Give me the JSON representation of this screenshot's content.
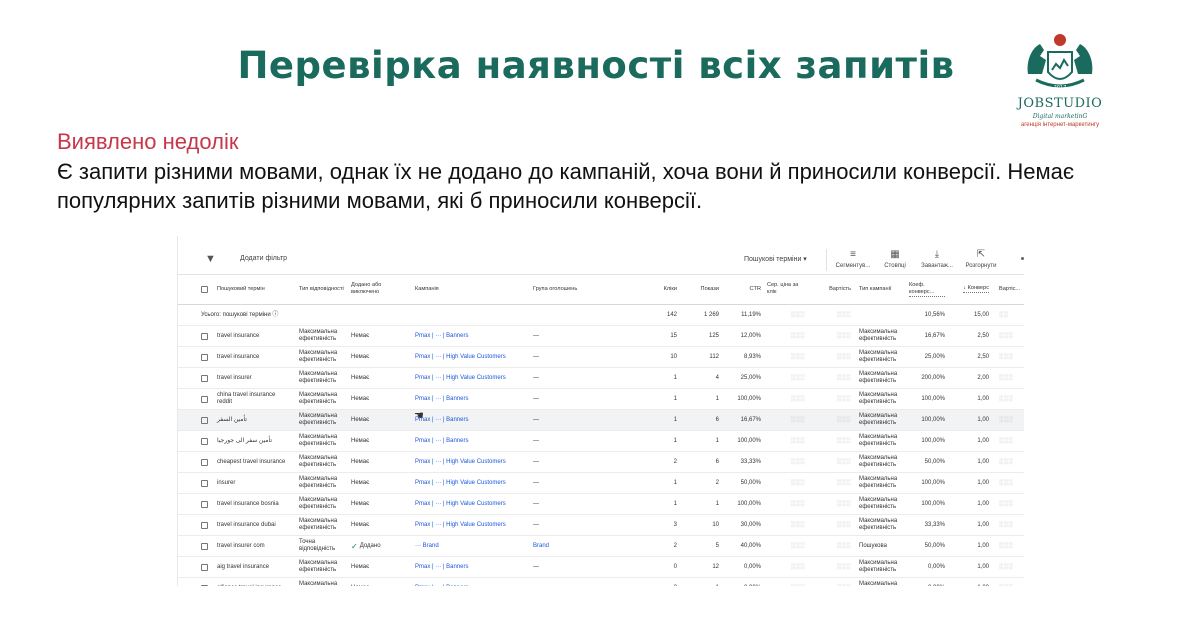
{
  "slide": {
    "title": "Перевірка наявності всіх запитів",
    "issue_label": "Виявлено недолік",
    "issue_text": "Є запити різними мовами, однак їх не додано до кампаній, хоча вони й приносили конверсії. Немає популярних запитів різними мовами, які б приносили конверсії.",
    "logo": {
      "brand": "JOBSTUDIO",
      "tagline": "Digital marketinG",
      "caption": "агенція інтернет-маркетингу",
      "colors": {
        "primary": "#1a6b5e",
        "accent": "#c0392b"
      }
    }
  },
  "toolbar": {
    "add_filter": "Додати фільтр",
    "view_select": "Пошукові терміни",
    "buttons": [
      {
        "label": "Сегментув...",
        "icon": "segment-icon"
      },
      {
        "label": "Стовпці",
        "icon": "columns-icon"
      },
      {
        "label": "Завантаж...",
        "icon": "download-icon"
      },
      {
        "label": "Розгорнути",
        "icon": "expand-icon"
      }
    ]
  },
  "table": {
    "headers": {
      "term": "Пошуковий термін",
      "match": "Тип відповідності",
      "added": "Додано або виключено",
      "campaign": "Кампанія",
      "adgroup": "Група оголошень",
      "clicks": "Кліки",
      "impr": "Покази",
      "ctr": "CTR",
      "cpc": "Сер. ціна за клік",
      "cost": "Вартість",
      "ctype": "Тип кампанії",
      "convrate": "Коеф. конверс...",
      "conv": "↓ Конверс",
      "convval": "Вартіс..."
    },
    "total": {
      "label": "Усього: пошукові терміни",
      "clicks": "142",
      "impr": "1 269",
      "ctr": "11,19%",
      "convrate": "10,56%",
      "conv": "15,00"
    },
    "rows": [
      {
        "term": "travel insurance",
        "match": "Максимальна ефективність",
        "added": "Немає",
        "campaign": "Pmax | ··· | Banners",
        "adgroup": "—",
        "clicks": "15",
        "impr": "125",
        "ctr": "12,00%",
        "ctype": "Максимальна ефективність",
        "convrate": "16,67%",
        "conv": "2,50"
      },
      {
        "term": "travel insurance",
        "match": "Максимальна ефективність",
        "added": "Немає",
        "campaign": "Pmax | ··· | High Value Customers",
        "adgroup": "—",
        "clicks": "10",
        "impr": "112",
        "ctr": "8,93%",
        "ctype": "Максимальна ефективність",
        "convrate": "25,00%",
        "conv": "2,50"
      },
      {
        "term": "travel insurer",
        "match": "Максимальна ефективність",
        "added": "Немає",
        "campaign": "Pmax | ··· | High Value Customers",
        "adgroup": "—",
        "clicks": "1",
        "impr": "4",
        "ctr": "25,00%",
        "ctype": "Максимальна ефективність",
        "convrate": "200,00%",
        "conv": "2,00"
      },
      {
        "term": "china travel insurance reddit",
        "match": "Максимальна ефективність",
        "added": "Немає",
        "campaign": "Pmax | ··· | Banners",
        "adgroup": "—",
        "clicks": "1",
        "impr": "1",
        "ctr": "100,00%",
        "ctype": "Максимальна ефективність",
        "convrate": "100,00%",
        "conv": "1,00"
      },
      {
        "term": "تأمين السفر",
        "match": "Максимальна ефективність",
        "added": "Немає",
        "campaign": "Pmax | ··· | Banners",
        "adgroup": "—",
        "clicks": "1",
        "impr": "6",
        "ctr": "16,67%",
        "ctype": "Максимальна ефективність",
        "convrate": "100,00%",
        "conv": "1,00"
      },
      {
        "term": "تأمين سفر الى جورجيا",
        "match": "Максимальна ефективність",
        "added": "Немає",
        "campaign": "Pmax | ··· | Banners",
        "adgroup": "—",
        "clicks": "1",
        "impr": "1",
        "ctr": "100,00%",
        "ctype": "Максимальна ефективність",
        "convrate": "100,00%",
        "conv": "1,00"
      },
      {
        "term": "cheapest travel insurance",
        "match": "Максимальна ефективність",
        "added": "Немає",
        "campaign": "Pmax | ··· | High Value Customers",
        "adgroup": "—",
        "clicks": "2",
        "impr": "6",
        "ctr": "33,33%",
        "ctype": "Максимальна ефективність",
        "convrate": "50,00%",
        "conv": "1,00"
      },
      {
        "term": "insurer",
        "match": "Максимальна ефективність",
        "added": "Немає",
        "campaign": "Pmax | ··· | High Value Customers",
        "adgroup": "—",
        "clicks": "1",
        "impr": "2",
        "ctr": "50,00%",
        "ctype": "Максимальна ефективність",
        "convrate": "100,00%",
        "conv": "1,00"
      },
      {
        "term": "travel insurance bosnia",
        "match": "Максимальна ефективність",
        "added": "Немає",
        "campaign": "Pmax | ··· | High Value Customers",
        "adgroup": "—",
        "clicks": "1",
        "impr": "1",
        "ctr": "100,00%",
        "ctype": "Максимальна ефективність",
        "convrate": "100,00%",
        "conv": "1,00"
      },
      {
        "term": "travel insurance dubai",
        "match": "Максимальна ефективність",
        "added": "Немає",
        "campaign": "Pmax | ··· | High Value Customers",
        "adgroup": "—",
        "clicks": "3",
        "impr": "10",
        "ctr": "30,00%",
        "ctype": "Максимальна ефективність",
        "convrate": "33,33%",
        "conv": "1,00"
      },
      {
        "term": "travel insurer com",
        "match": "Точна відповідність",
        "added": "Додано",
        "campaign": "··· Brand",
        "adgroup": "Brand",
        "clicks": "2",
        "impr": "5",
        "ctr": "40,00%",
        "ctype": "Пошукова",
        "convrate": "50,00%",
        "conv": "1,00"
      },
      {
        "term": "aig travel insurance",
        "match": "Максимальна ефективність",
        "added": "Немає",
        "campaign": "Pmax | ··· | Banners",
        "adgroup": "—",
        "clicks": "0",
        "impr": "12",
        "ctr": "0,00%",
        "ctype": "Максимальна ефективність",
        "convrate": "0,00%",
        "conv": "1,00"
      },
      {
        "term": "alliance travel insurance",
        "match": "Максимальна ефективність",
        "added": "Немає",
        "campaign": "Pmax | ··· | Banners",
        "adgroup": "—",
        "clicks": "0",
        "impr": "1",
        "ctr": "0,00%",
        "ctype": "Максимальна ефективність",
        "convrate": "0,00%",
        "conv": "1,00"
      },
      {
        "term": "",
        "match": "Максимальна",
        "added": "",
        "campaign": "",
        "adgroup": "",
        "clicks": "",
        "impr": "",
        "ctr": "",
        "ctype": "Максимальна",
        "convrate": "",
        "conv": ""
      }
    ]
  }
}
